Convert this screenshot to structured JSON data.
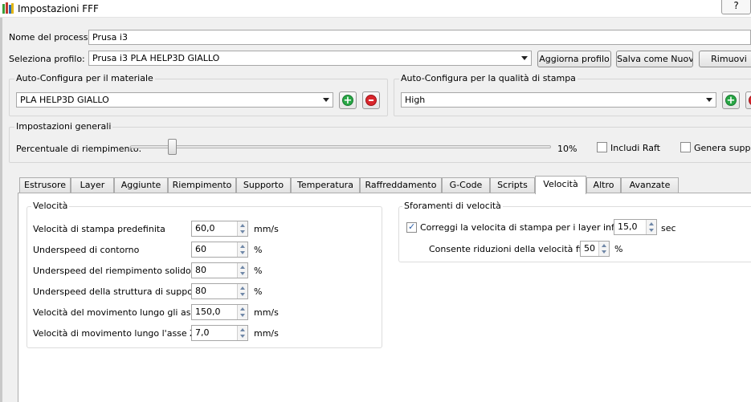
{
  "window": {
    "title": "Impostazioni FFF",
    "help_label": "?"
  },
  "process": {
    "name_label": "Nome del processo:",
    "name_value": "Prusa i3"
  },
  "profile": {
    "label": "Seleziona profilo:",
    "selected": "Prusa i3 PLA HELP3D GIALLO",
    "update_label": "Aggiorna profilo",
    "save_new_label": "Salva come Nuovo",
    "remove_label": "Rimuovi"
  },
  "material": {
    "group_title": "Auto-Configura per il materiale",
    "selected": "PLA HELP3D GIALLO"
  },
  "quality": {
    "group_title": "Auto-Configura per la qualità di stampa",
    "selected": "High"
  },
  "general": {
    "group_title": "Impostazioni generali",
    "infill_label": "Percentuale di riempimento:",
    "infill_value_text": "10%",
    "infill_fraction": 0.1,
    "raft_label": "Includi Raft",
    "raft_checked": false,
    "support_label": "Genera supporti",
    "support_checked": false
  },
  "tabs": [
    {
      "label": "Estrusore"
    },
    {
      "label": "Layer"
    },
    {
      "label": "Aggiunte"
    },
    {
      "label": "Riempimento"
    },
    {
      "label": "Supporto"
    },
    {
      "label": "Temperatura"
    },
    {
      "label": "Raffreddamento"
    },
    {
      "label": "G-Code"
    },
    {
      "label": "Scripts"
    },
    {
      "label": "Velocità"
    },
    {
      "label": "Altro"
    },
    {
      "label": "Avanzate"
    }
  ],
  "active_tab": "Velocità",
  "speed": {
    "group_title": "Velocità",
    "rows": [
      {
        "label": "Velocità di stampa predefinita",
        "value": "60,0",
        "unit": "mm/s"
      },
      {
        "label": "Underspeed di contorno",
        "value": "60",
        "unit": "%"
      },
      {
        "label": "Underspeed del riempimento solido",
        "value": "80",
        "unit": "%"
      },
      {
        "label": "Underspeed della struttura di supporto",
        "value": "80",
        "unit": "%"
      },
      {
        "label": "Velocità del movimento lungo gli assi X/Y",
        "value": "150,0",
        "unit": "mm/s"
      },
      {
        "label": "Velocità di movimento lungo l'asse Z",
        "value": "7,0",
        "unit": "mm/s"
      }
    ]
  },
  "slowdown": {
    "group_title": "Sforamenti di velocità",
    "adjust_label": "Correggi la velocita di stampa per i layer inferiori",
    "adjust_checked": true,
    "adjust_value": "15,0",
    "adjust_unit": "sec",
    "reduction_label": "Consente riduzioni della velocità fino a",
    "reduction_value": "50",
    "reduction_unit": "%"
  },
  "colors": {
    "add_green": "#28a745",
    "remove_red": "#d9262c",
    "spin_arrow": "#7088a8"
  }
}
